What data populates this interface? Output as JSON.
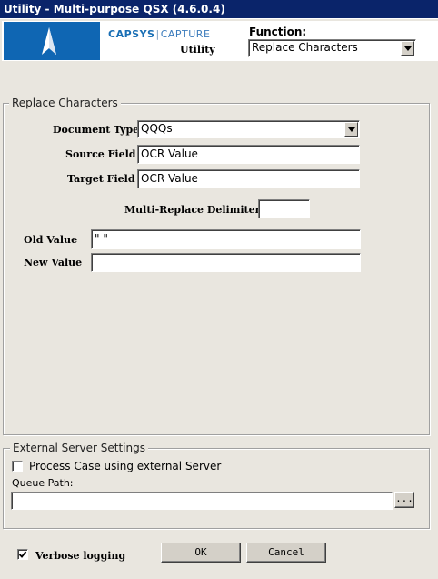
{
  "window": {
    "title": "Utility - Multi-purpose QSX (4.6.0.4)"
  },
  "header": {
    "brand_left": "CAPSYS",
    "brand_right": "CAPTURE",
    "subtitle": "Utility",
    "function_label": "Function:",
    "function_value": "Replace Characters"
  },
  "replace": {
    "group_label": "Replace Characters",
    "document_type_label": "Document Type",
    "document_type_value": "QQQs",
    "source_field_label": "Source Field",
    "source_field_value": "OCR Value",
    "target_field_label": "Target Field",
    "target_field_value": "OCR Value",
    "delimiter_label": "Multi-Replace Delimiter",
    "delimiter_value": "",
    "old_value_label": "Old Value",
    "old_value_value": "\" \"",
    "new_value_label": "New Value",
    "new_value_value": ""
  },
  "external": {
    "group_label": "External Server Settings",
    "process_label": "Process Case using external Server",
    "process_checked": false,
    "queue_path_label": "Queue Path:",
    "queue_path_value": "",
    "browse_label": "..."
  },
  "footer": {
    "verbose_label": "Verbose logging",
    "verbose_checked": true,
    "ok_label": "OK",
    "cancel_label": "Cancel"
  },
  "colors": {
    "titlebar": "#0a246a",
    "logo_background": "#0f66b3",
    "window_background": "#e9e6df"
  }
}
